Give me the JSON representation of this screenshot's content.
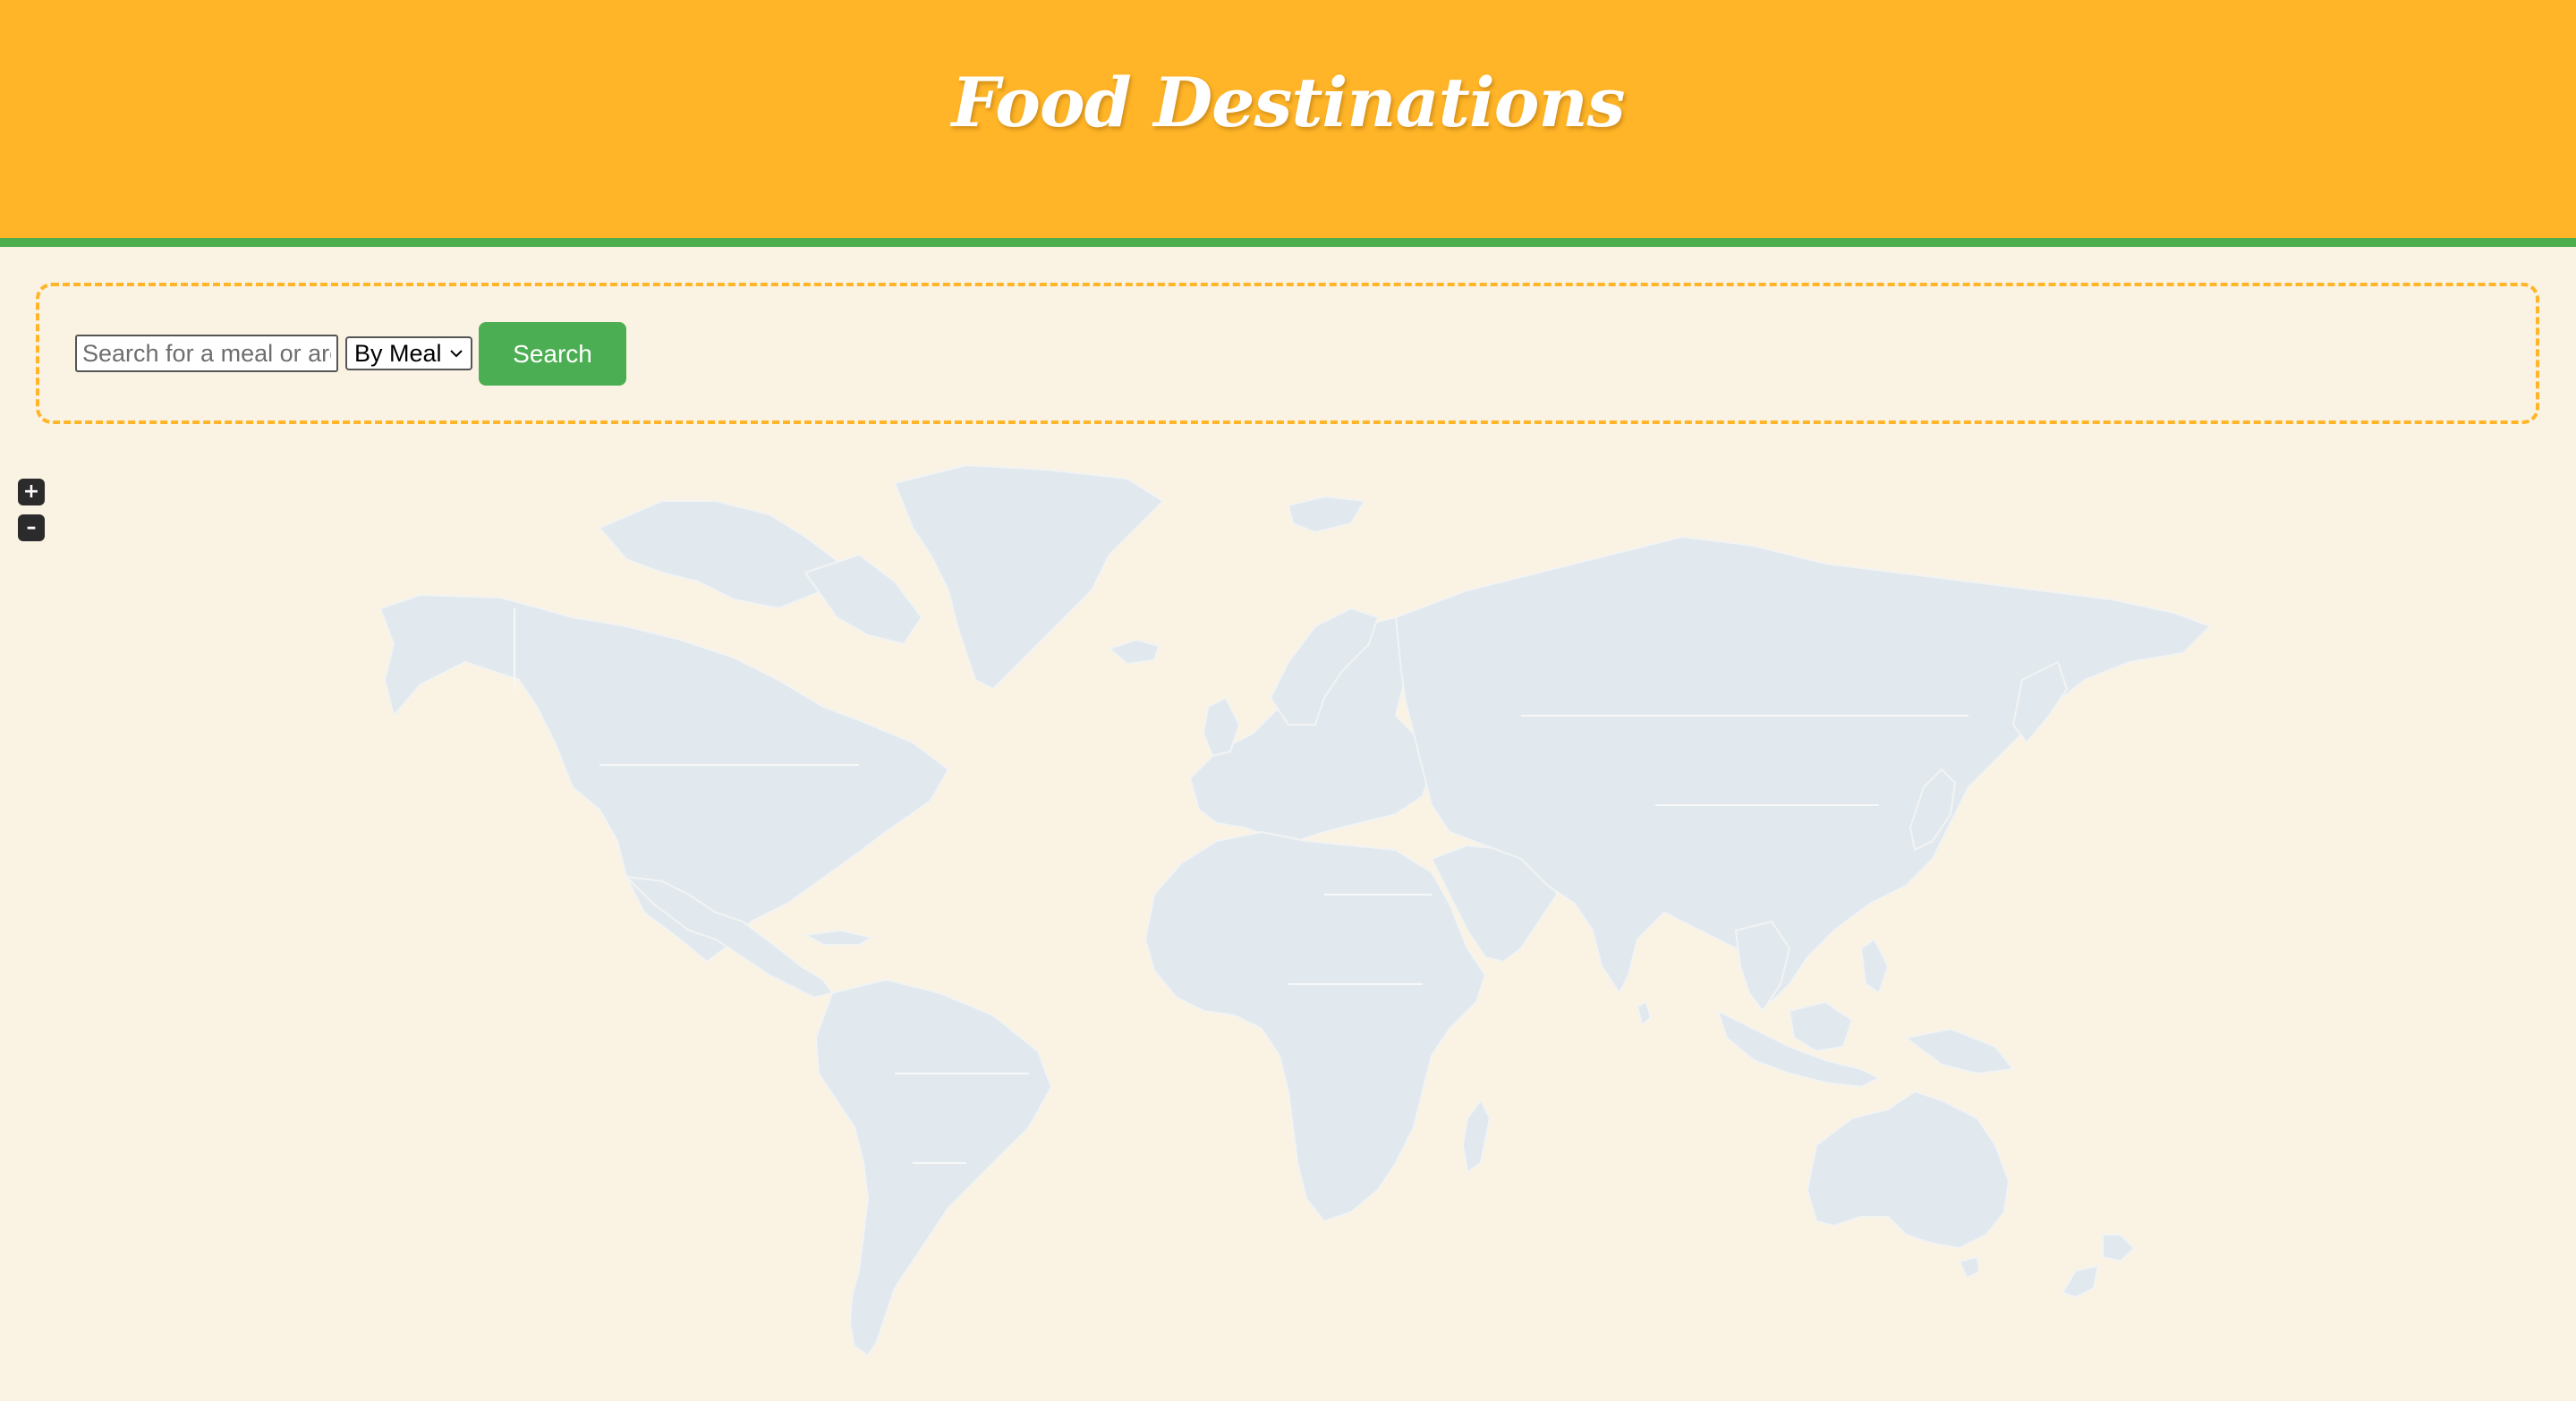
{
  "header": {
    "title": "Food Destinations"
  },
  "search": {
    "placeholder": "Search for a meal or area",
    "value": "",
    "mode_selected": "By Meal",
    "button_label": "Search"
  },
  "map_controls": {
    "zoom_in_label": "+",
    "zoom_out_label": "–"
  },
  "colors": {
    "header_bg": "#ffb527",
    "header_border": "#4cae4c",
    "page_bg": "#faf3e3",
    "button_bg": "#4cae52",
    "land": "#e2e9ee"
  },
  "icons": {
    "select": "chevron-down-icon",
    "zoom_in": "plus-icon",
    "zoom_out": "minus-icon"
  }
}
